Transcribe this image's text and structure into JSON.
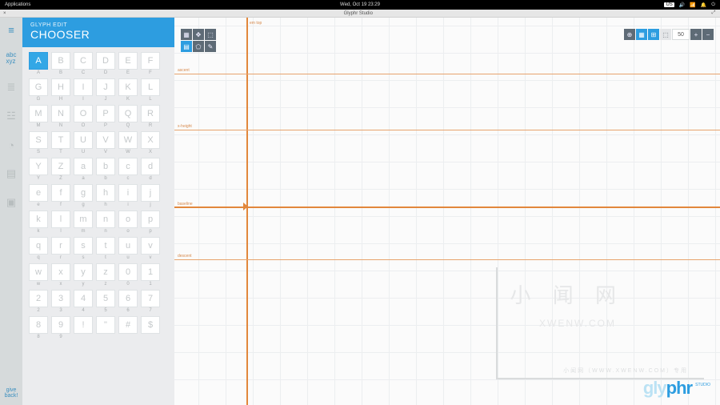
{
  "os": {
    "left": "Applications",
    "center": "Wed, Oct 19   23:29",
    "indicator": "US"
  },
  "window": {
    "close": "×",
    "title": "Glyphr Studio",
    "max": "⤢"
  },
  "rail": {
    "menu_icon": "≡",
    "items": [
      "abc\nxyz",
      "≣",
      "☳",
      "◔",
      "▤",
      "▣"
    ],
    "give_label": "give\nback!"
  },
  "panel": {
    "subtitle": "GLYPH EDIT",
    "title": "CHOOSER",
    "glyphs": [
      {
        "g": "A",
        "l": "A",
        "sel": true
      },
      {
        "g": "B",
        "l": "B"
      },
      {
        "g": "C",
        "l": "C"
      },
      {
        "g": "D",
        "l": "D"
      },
      {
        "g": "E",
        "l": "E"
      },
      {
        "g": "F",
        "l": "F"
      },
      {
        "g": "G",
        "l": "G"
      },
      {
        "g": "H",
        "l": "H"
      },
      {
        "g": "I",
        "l": "I"
      },
      {
        "g": "J",
        "l": "J"
      },
      {
        "g": "K",
        "l": "K"
      },
      {
        "g": "L",
        "l": "L"
      },
      {
        "g": "M",
        "l": "M"
      },
      {
        "g": "N",
        "l": "N"
      },
      {
        "g": "O",
        "l": "O"
      },
      {
        "g": "P",
        "l": "P"
      },
      {
        "g": "Q",
        "l": "Q"
      },
      {
        "g": "R",
        "l": "R"
      },
      {
        "g": "S",
        "l": "S"
      },
      {
        "g": "T",
        "l": "T"
      },
      {
        "g": "U",
        "l": "U"
      },
      {
        "g": "V",
        "l": "V"
      },
      {
        "g": "W",
        "l": "W"
      },
      {
        "g": "X",
        "l": "X"
      },
      {
        "g": "Y",
        "l": "Y"
      },
      {
        "g": "Z",
        "l": "Z"
      },
      {
        "g": "a",
        "l": "a"
      },
      {
        "g": "b",
        "l": "b"
      },
      {
        "g": "c",
        "l": "c"
      },
      {
        "g": "d",
        "l": "d"
      },
      {
        "g": "e",
        "l": "e"
      },
      {
        "g": "f",
        "l": "f"
      },
      {
        "g": "g",
        "l": "g"
      },
      {
        "g": "h",
        "l": "h"
      },
      {
        "g": "i",
        "l": "i"
      },
      {
        "g": "j",
        "l": "j"
      },
      {
        "g": "k",
        "l": "k"
      },
      {
        "g": "l",
        "l": "l"
      },
      {
        "g": "m",
        "l": "m"
      },
      {
        "g": "n",
        "l": "n"
      },
      {
        "g": "o",
        "l": "o"
      },
      {
        "g": "p",
        "l": "p"
      },
      {
        "g": "q",
        "l": "q"
      },
      {
        "g": "r",
        "l": "r"
      },
      {
        "g": "s",
        "l": "s"
      },
      {
        "g": "t",
        "l": "t"
      },
      {
        "g": "u",
        "l": "u"
      },
      {
        "g": "v",
        "l": "v"
      },
      {
        "g": "w",
        "l": "w"
      },
      {
        "g": "x",
        "l": "x"
      },
      {
        "g": "y",
        "l": "y"
      },
      {
        "g": "z",
        "l": "z"
      },
      {
        "g": "0",
        "l": "0"
      },
      {
        "g": "1",
        "l": "1"
      },
      {
        "g": "2",
        "l": "2"
      },
      {
        "g": "3",
        "l": "3"
      },
      {
        "g": "4",
        "l": "4"
      },
      {
        "g": "5",
        "l": "5"
      },
      {
        "g": "6",
        "l": "6"
      },
      {
        "g": "7",
        "l": "7"
      },
      {
        "g": "8",
        "l": "8"
      },
      {
        "g": "9",
        "l": "9"
      },
      {
        "g": "!",
        "l": ""
      },
      {
        "g": "\"",
        "l": ""
      },
      {
        "g": "#",
        "l": ""
      },
      {
        "g": "$",
        "l": ""
      }
    ]
  },
  "canvas": {
    "tools_left": [
      "▦",
      "✥",
      "⬚",
      "▤",
      "⬠",
      "✎"
    ],
    "view_right": [
      "⊕",
      "▦",
      "⊞",
      "⬚"
    ],
    "zoom_value": "50",
    "zoom_plus": "+",
    "zoom_minus": "−",
    "metrics": {
      "em_top": "em top",
      "ascent": "ascent",
      "xheight": "x-height",
      "baseline": "baseline",
      "descent": "descent"
    }
  },
  "watermark": {
    "big": "小 闻 网",
    "url": "XWENW.COM",
    "note": "小闻网（WWW.XWENW.COM）专用",
    "logo_a": "gly",
    "logo_b": "phr",
    "logo_sub": "STUDIO"
  }
}
